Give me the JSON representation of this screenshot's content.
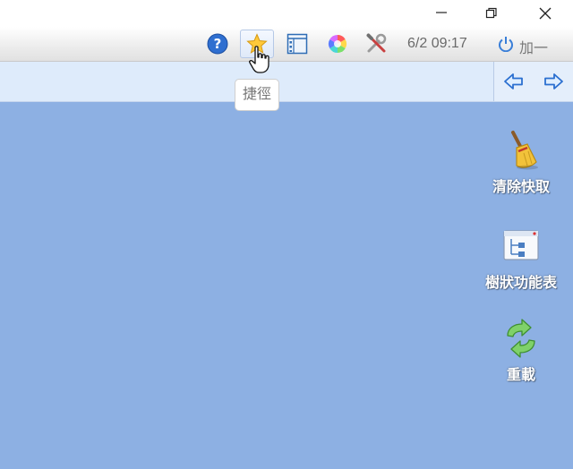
{
  "toolbar": {
    "icons": [
      "help-icon",
      "star-icon",
      "tree-menu-icon",
      "color-wheel-icon",
      "tools-icon"
    ],
    "datetime": "6/2 09:17",
    "user_label": "加一"
  },
  "tooltip": {
    "text": "捷徑"
  },
  "desktop": {
    "items": [
      {
        "label": "清除快取",
        "icon": "broom-icon"
      },
      {
        "label": "樹狀功能表",
        "icon": "tree-menu-icon"
      },
      {
        "label": "重載",
        "icon": "reload-icon"
      }
    ]
  },
  "colors": {
    "desktop_bg": "#8db0e3",
    "navbar_bg": "#deebfb",
    "accent": "#3a78d8"
  }
}
